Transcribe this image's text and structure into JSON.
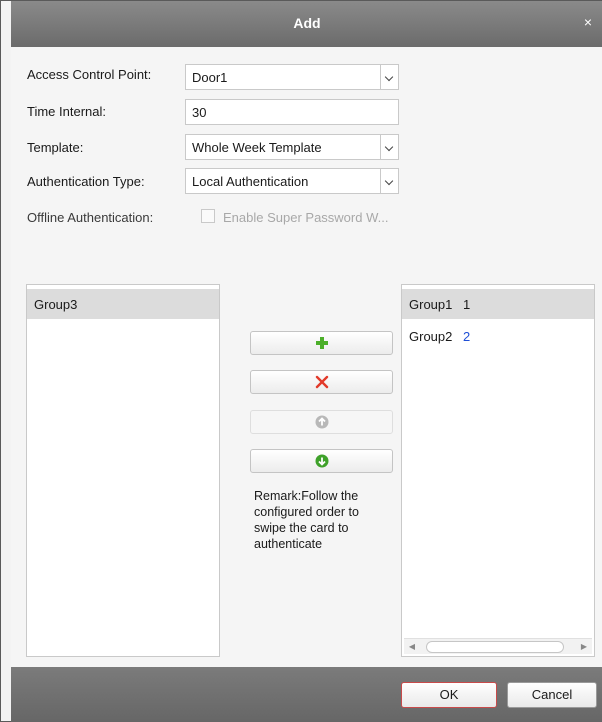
{
  "dialog": {
    "title": "Add",
    "close_glyph": "×"
  },
  "form": {
    "access_control_point": {
      "label": "Access Control Point:",
      "value": "Door1"
    },
    "time_interval": {
      "label": "Time Internal:",
      "value": "30"
    },
    "template": {
      "label": "Template:",
      "value": "Whole Week Template"
    },
    "authentication_type": {
      "label": "Authentication Type:",
      "value": "Local Authentication"
    },
    "offline_authentication": {
      "label": "Offline Authentication:",
      "checkbox_label": "Enable Super Password W...",
      "checked": false,
      "enabled": false
    }
  },
  "left_list": {
    "items": [
      {
        "name": "Group3"
      }
    ]
  },
  "right_list": {
    "items": [
      {
        "name": "Group1",
        "order": "1"
      },
      {
        "name": "Group2",
        "order": "2"
      }
    ]
  },
  "actions": {
    "add_icon": "plus-icon",
    "remove_icon": "x-icon",
    "move_up_icon": "arrow-up-circle-icon",
    "move_down_icon": "arrow-down-circle-icon"
  },
  "remark": "Remark:Follow the configured order to swipe the card to authenticate",
  "footer": {
    "ok_label": "OK",
    "cancel_label": "Cancel"
  },
  "colors": {
    "accent_green": "#4caf2a",
    "remove_red": "#e23a2a",
    "link_blue": "#1f4fd6",
    "ok_border": "#c84a4a"
  }
}
